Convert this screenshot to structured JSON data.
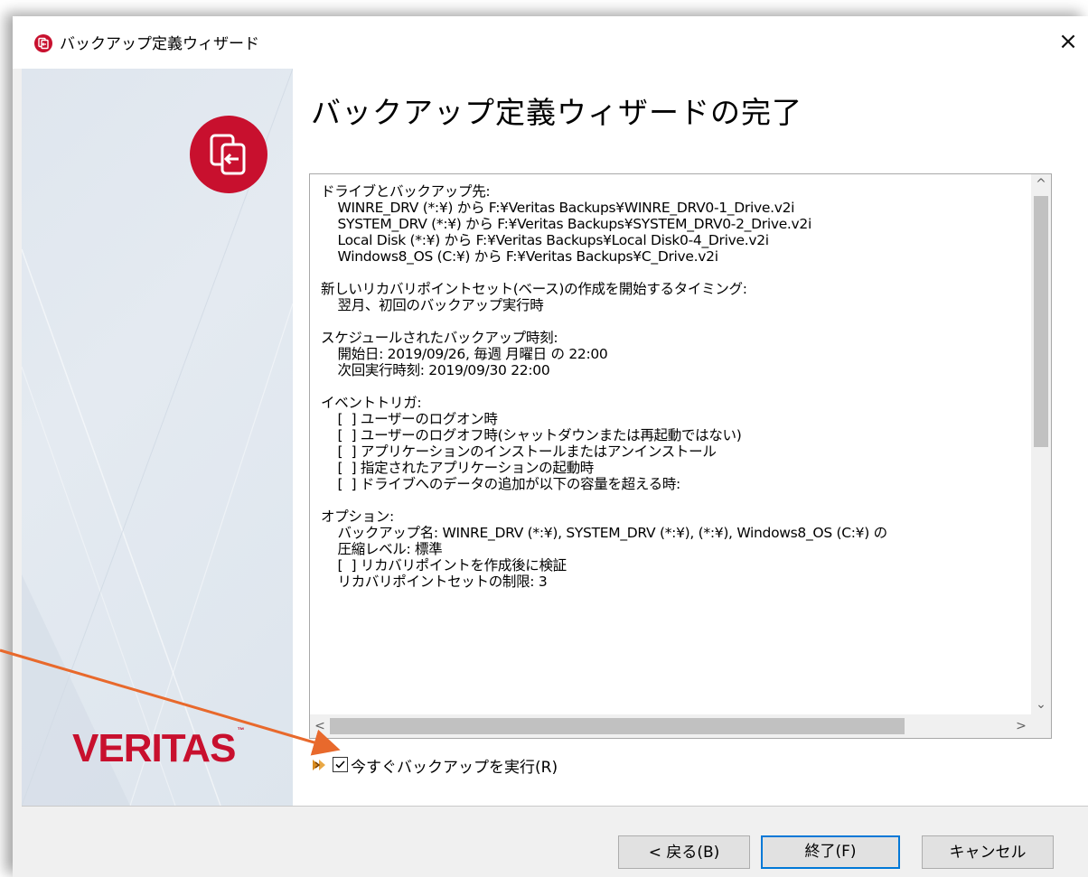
{
  "window": {
    "title": "バックアップ定義ウィザード",
    "close_symbol": "×"
  },
  "sidebar": {
    "brand": "VERITAS",
    "trademark": "™"
  },
  "content": {
    "heading": "バックアップ定義ウィザードの完了",
    "summary_lines": [
      "ドライブとバックアップ先:",
      "    WINRE_DRV (*:¥) から F:¥Veritas Backups¥WINRE_DRV0-1_Drive.v2i",
      "    SYSTEM_DRV (*:¥) から F:¥Veritas Backups¥SYSTEM_DRV0-2_Drive.v2i",
      "    Local Disk (*:¥) から F:¥Veritas Backups¥Local Disk0-4_Drive.v2i",
      "    Windows8_OS (C:¥) から F:¥Veritas Backups¥C_Drive.v2i",
      "",
      "新しいリカバリポイントセット(ベース)の作成を開始するタイミング:",
      "    翌月、初回のバックアップ実行時",
      "",
      "スケジュールされたバックアップ時刻:",
      "    開始日: 2019/09/26, 毎週 月曜日 の 22:00",
      "    次回実行時刻: 2019/09/30 22:00",
      "",
      "イベントトリガ:",
      "    [  ] ユーザーのログオン時",
      "    [  ] ユーザーのログオフ時(シャットダウンまたは再起動ではない)",
      "    [  ] アプリケーションのインストールまたはアンインストール",
      "    [  ] 指定されたアプリケーションの起動時",
      "    [  ] ドライブへのデータの追加が以下の容量を超える時:",
      "",
      "オプション:",
      "    バックアップ名: WINRE_DRV (*:¥), SYSTEM_DRV (*:¥), (*:¥), Windows8_OS (C:¥) の",
      "    圧縮レベル: 標準",
      "    [  ] リカバリポイントを作成後に検証",
      "    リカバリポイントセットの制限: 3"
    ],
    "scroll": {
      "up": "^",
      "down": "⌄",
      "left": "<",
      "right": ">"
    },
    "run_now": {
      "label": "今すぐバックアップを実行(R)",
      "checked": true
    }
  },
  "buttons": {
    "back": "< 戻る(B)",
    "finish": "終了(F)",
    "cancel": "キャンセル"
  },
  "colors": {
    "brand": "#c8102e",
    "accent": "#0078d7",
    "callout_arrow": "#e8692c"
  }
}
